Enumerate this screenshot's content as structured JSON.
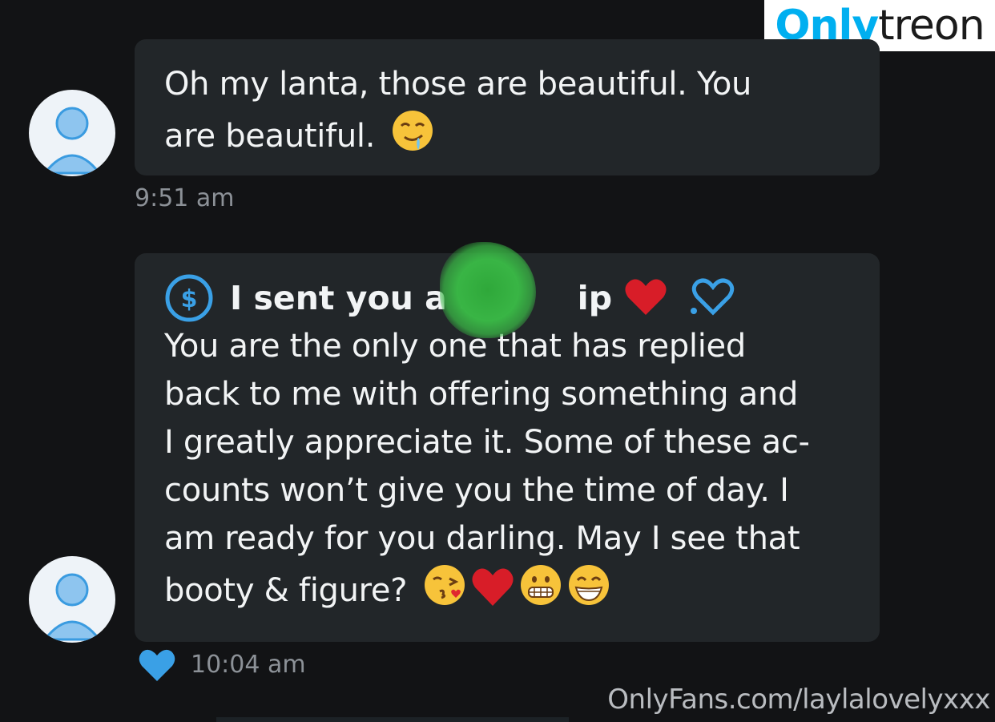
{
  "brand_logo": {
    "part1": "Only",
    "part2": "treon"
  },
  "messages": [
    {
      "text_line1": "Oh my lanta, those are beautiful. You",
      "text_line2": "are beautiful.",
      "emojis": [
        "drooling-face"
      ],
      "time": "9:51 am"
    },
    {
      "tip_text": "I sent you a $",
      "tip_suffix": "ip",
      "lines": [
        "You are the only one that has replied",
        "back to me with offering something and",
        "I greatly appreciate it. Some of these ac-",
        "counts won’t give you the time of day. I",
        "am ready for you darling. May I see that",
        "booty & figure?"
      ],
      "emojis": [
        "kissing-heart-face",
        "red-heart",
        "grimacing-face",
        "grinning-face"
      ],
      "time": "10:04 am",
      "liked": true
    }
  ],
  "watermark": "OnlyFans.com/laylalovelyxxx",
  "colors": {
    "background": "#121315",
    "bubble": "#222629",
    "accent_blue": "#3aa0e6",
    "timestamp": "#8c9197",
    "brand_blue": "#00aff0"
  }
}
